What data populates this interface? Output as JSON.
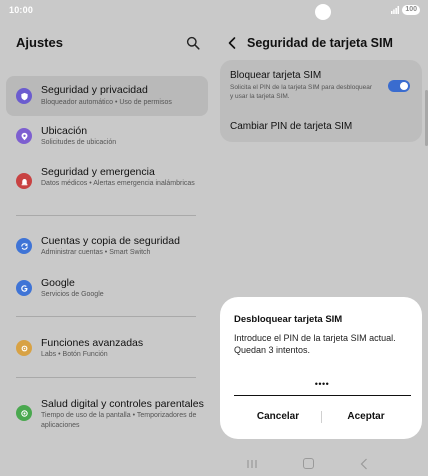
{
  "status": {
    "time": "10:00",
    "battery": "100"
  },
  "left": {
    "title": "Ajustes",
    "items": [
      {
        "title": "Seguridad y privacidad",
        "subtitle": "Bloqueador automático • Uso de permisos",
        "icon": "shield-icon",
        "color": "#6b5ccf",
        "selected": true
      },
      {
        "title": "Ubicación",
        "subtitle": "Solicitudes de ubicación",
        "icon": "location-pin-icon",
        "color": "#7d5fd0"
      },
      {
        "title": "Seguridad y emergencia",
        "subtitle": "Datos médicos • Alertas emergencia inalámbricas",
        "icon": "emergency-siren-icon",
        "color": "#c84242"
      },
      {
        "title": "Cuentas y copia de seguridad",
        "subtitle": "Administrar cuentas • Smart Switch",
        "icon": "sync-icon",
        "color": "#3f74d6"
      },
      {
        "title": "Google",
        "subtitle": "Servicios de Google",
        "icon": "google-icon",
        "color": "#3f74d6"
      },
      {
        "title": "Funciones avanzadas",
        "subtitle": "Labs • Botón Función",
        "icon": "gear-plus-icon",
        "color": "#d8a244"
      },
      {
        "title": "Salud digital y controles parentales",
        "subtitle": "Tiempo de uso de la pantalla • Temporizadores de aplicaciones",
        "icon": "wellbeing-icon",
        "color": "#4aa84f"
      }
    ]
  },
  "right": {
    "title": "Seguridad de tarjeta SIM",
    "lock_sim": {
      "title": "Bloquear tarjeta SIM",
      "description": "Solicita el PIN de la tarjeta SIM para desbloquear y usar la tarjeta SIM.",
      "enabled": true
    },
    "change_pin": "Cambiar PIN de tarjeta SIM"
  },
  "dialog": {
    "title": "Desbloquear tarjeta SIM",
    "message": "Introduce el PIN de la tarjeta SIM actual.",
    "attempts": "Quedan 3 intentos.",
    "pin_value": "••••",
    "cancel": "Cancelar",
    "accept": "Aceptar"
  },
  "colors": {
    "toggle_on": "#3a6ccf",
    "selected_row": "#b9b9b9",
    "background": "#c9c9c9"
  }
}
